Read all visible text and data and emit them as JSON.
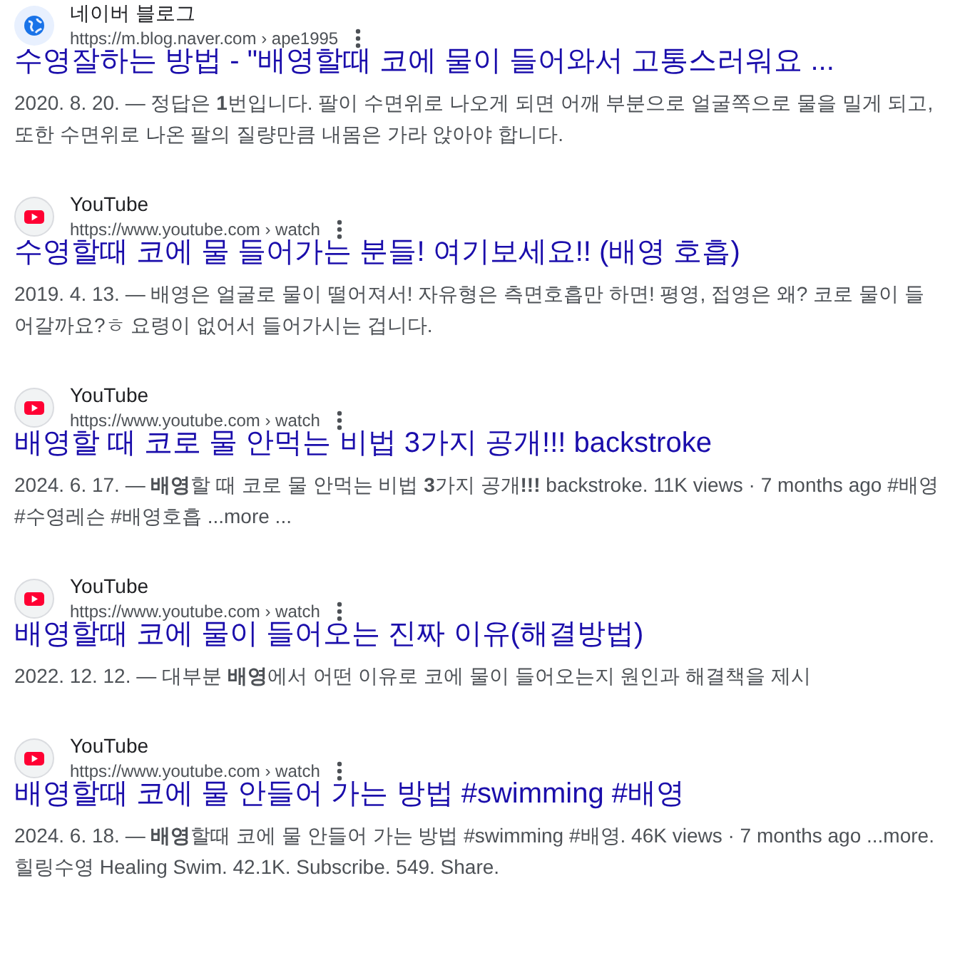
{
  "results": [
    {
      "kind": "globe",
      "site": "네이버 블로그",
      "url": "https://m.blog.naver.com › ape1995",
      "title": "수영잘하는 방법 - \"배영할때 코에 물이 들어와서 고통스러워요 ...",
      "snippet": "2020. 8. 20. — 정답은 **1**번입니다. 팔이 수면위로 나오게 되면 어깨 부분으로 얼굴쪽으로 물을 밀게 되고, 또한 수면위로 나온 팔의 질량만큼 내몸은 가라 앉아야 합니다."
    },
    {
      "kind": "youtube",
      "site": "YouTube",
      "url": "https://www.youtube.com › watch",
      "title": "수영할때 코에 물 들어가는 분들! 여기보세요!! (배영 호흡)",
      "snippet": "2019. 4. 13. — 배영은 얼굴로 물이 떨어져서! 자유형은 측면호흡만 하면! 평영, 접영은 왜? 코로 물이 들어갈까요?ㅎ 요령이 없어서 들어가시는 겁니다."
    },
    {
      "kind": "youtube",
      "site": "YouTube",
      "url": "https://www.youtube.com › watch",
      "title": "배영할 때 코로 물 안먹는 비법 3가지 공개!!! backstroke",
      "snippet": "2024. 6. 17. — **배영**할 때 코로 물 안먹는 비법 **3**가지 공개**!!!** backstroke. 11K views · 7 months ago #배영 #수영레슨 #배영호흡 ...more ..."
    },
    {
      "kind": "youtube",
      "site": "YouTube",
      "url": "https://www.youtube.com › watch",
      "title": "배영할때 코에 물이 들어오는 진짜 이유(해결방법)",
      "snippet": "2022. 12. 12. — 대부분 **배영**에서 어떤 이유로 코에 물이 들어오는지 원인과 해결책을 제시"
    },
    {
      "kind": "youtube",
      "site": "YouTube",
      "url": "https://www.youtube.com › watch",
      "title": "배영할때 코에 물 안들어 가는 방법 #swimming #배영",
      "snippet": "2024. 6. 18. — **배영**할때 코에 물 안들어 가는 방법 #swimming #배영. 46K views · 7 months ago ...more. 힐링수영 Healing Swim. 42.1K. Subscribe. 549. Share."
    }
  ]
}
